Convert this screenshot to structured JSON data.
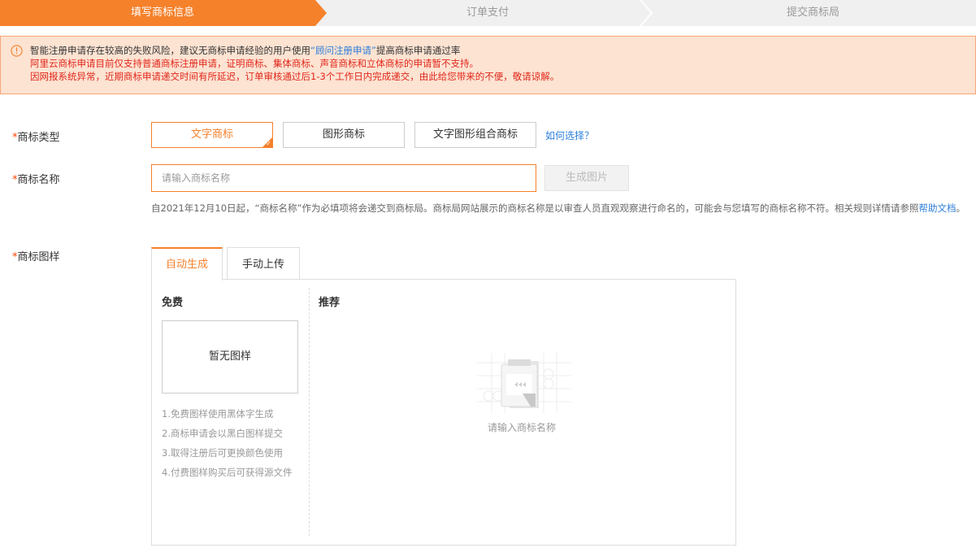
{
  "steps": [
    "填写商标信息",
    "订单支付",
    "提交商标局"
  ],
  "colors": {
    "accent": "#f5812b",
    "notice_bg": "#fde3d2",
    "notice_text": "#e0271b",
    "link": "#2d7ed9"
  },
  "notice": {
    "line1_pre": "智能注册申请存在较高的失败风险，建议无商标申请经验的用户使用",
    "line1_link": "“顾问注册申请”",
    "line1_post": "提高商标申请通过率",
    "line2": "阿里云商标申请目前仅支持普通商标注册申请，证明商标、集体商标、声音商标和立体商标的申请暂不支持。",
    "line3": "因网报系统异常，近期商标申请递交时间有所延迟，订单审核通过后1-3个工作日内完成递交，由此给您带来的不便，敬请谅解。"
  },
  "form": {
    "type_label": "商标类型",
    "type_options": [
      "文字商标",
      "图形商标",
      "文字图形组合商标"
    ],
    "type_selected": "文字商标",
    "how_link": "如何选择？",
    "name_label": "商标名称",
    "name_placeholder": "请输入商标名称",
    "gen_button": "生成图片",
    "hint_text": "自2021年12月10日起，“商标名称”作为必填项将会递交到商标局。商标局网站展示的商标名称是以审查人员直观观察进行命名的，可能会与您填写的商标名称不符。相关规则详情请参照",
    "hint_link": "帮助文档",
    "hint_end": "。",
    "sample_label": "商标图样"
  },
  "tabs": [
    "自动生成",
    "手动上传"
  ],
  "panel": {
    "free_title": "免费",
    "no_sample": "暂无图样",
    "tips": [
      "1.免费图样使用黑体字生成",
      "2.商标申请会以黑白图样提交",
      "3.取得注册后可更换颜色使用",
      "4.付费图样购买后可获得源文件"
    ],
    "rec_title": "推荐",
    "empty_text": "请输入商标名称"
  }
}
